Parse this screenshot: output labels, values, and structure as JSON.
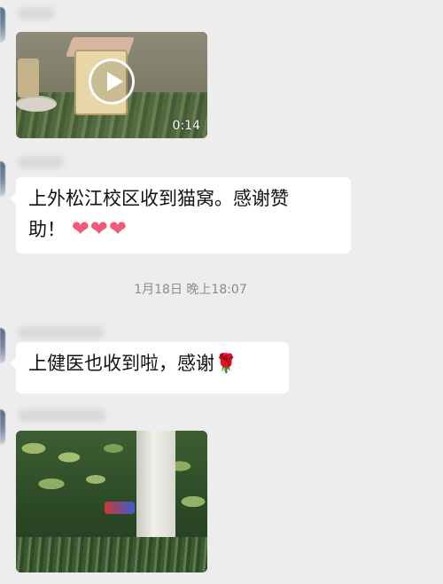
{
  "messages": [
    {
      "type": "video",
      "duration": "0:14"
    },
    {
      "type": "text",
      "line1": "上外松江校区收到猫窝。感谢赞",
      "line2": "助！",
      "emoji": "❤❤❤",
      "emoji_name": "heart-icon"
    },
    {
      "type": "timestamp",
      "text": "1月18日 晚上18:07"
    },
    {
      "type": "text",
      "text": "上健医也收到啦，感谢",
      "emoji": "🌹",
      "emoji_name": "rose-icon"
    },
    {
      "type": "image"
    }
  ],
  "colors": {
    "background": "#ededed",
    "bubble": "#ffffff",
    "heart": "#ef5a79",
    "timestamp": "#8c8c8c"
  }
}
